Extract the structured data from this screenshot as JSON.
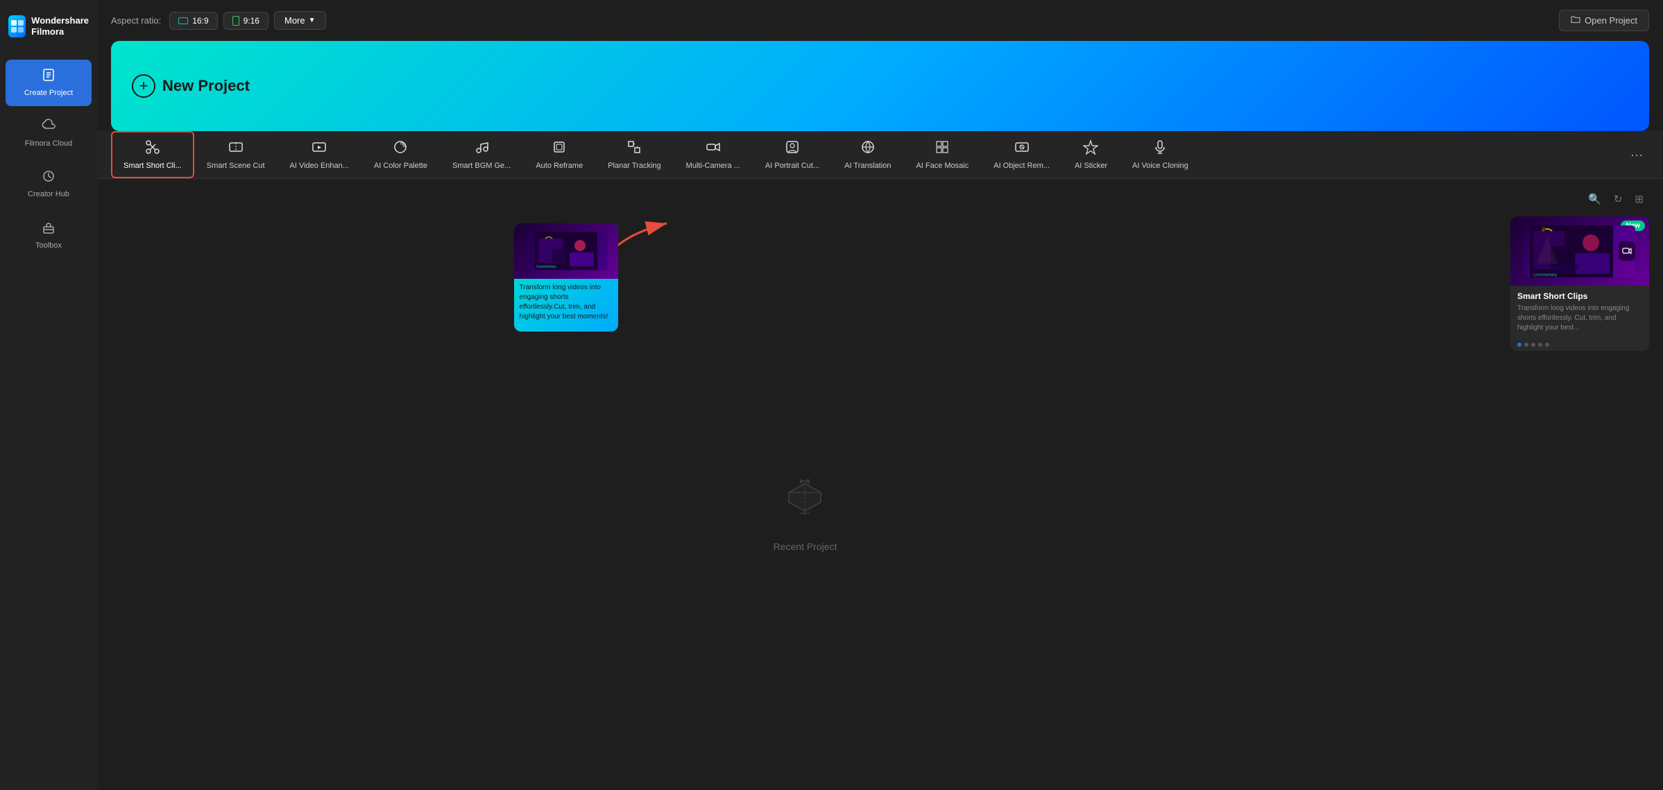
{
  "app": {
    "name": "Wondershare",
    "name2": "Filmora"
  },
  "sidebar": {
    "items": [
      {
        "id": "create-project",
        "label": "Create Project",
        "icon": "📄",
        "active": true
      },
      {
        "id": "filmora-cloud",
        "label": "Filmora Cloud",
        "icon": "☁"
      },
      {
        "id": "creator-hub",
        "label": "Creator Hub",
        "icon": "🎨"
      },
      {
        "id": "toolbox",
        "label": "Toolbox",
        "icon": "🧰"
      }
    ]
  },
  "topbar": {
    "aspect_label": "Aspect ratio:",
    "ratio_16_9": "16:9",
    "ratio_9_16": "9:16",
    "more_label": "More",
    "open_project_label": "Open Project"
  },
  "hero": {
    "new_project_label": "New Project"
  },
  "features": [
    {
      "id": "smart-short-clips",
      "label": "Smart Short Cli...",
      "icon": "✂",
      "active": true
    },
    {
      "id": "smart-scene-cut",
      "label": "Smart Scene Cut",
      "icon": "🎬"
    },
    {
      "id": "ai-video-enhance",
      "label": "AI Video Enhan...",
      "icon": "✨"
    },
    {
      "id": "ai-color-palette",
      "label": "AI Color Palette",
      "icon": "🎨"
    },
    {
      "id": "smart-bgm-ge",
      "label": "Smart BGM Ge...",
      "icon": "🎵"
    },
    {
      "id": "auto-reframe",
      "label": "Auto Reframe",
      "icon": "⬜"
    },
    {
      "id": "planar-tracking",
      "label": "Planar Tracking",
      "icon": "🎯"
    },
    {
      "id": "multi-camera",
      "label": "Multi-Camera ...",
      "icon": "📷"
    },
    {
      "id": "ai-portrait-cut",
      "label": "AI Portrait Cut...",
      "icon": "👤"
    },
    {
      "id": "ai-translation",
      "label": "AI Translation",
      "icon": "🌐"
    },
    {
      "id": "ai-face-mosaic",
      "label": "AI Face Mosaic",
      "icon": "🔲"
    },
    {
      "id": "ai-object-rem",
      "label": "AI Object Rem...",
      "icon": "🖼"
    },
    {
      "id": "ai-sticker",
      "label": "AI Sticker",
      "icon": "⭐"
    },
    {
      "id": "ai-voice-cloning",
      "label": "AI Voice Cloning",
      "icon": "🎤"
    }
  ],
  "tooltip": {
    "text": "Transform long videos into engaging shorts effortlessly.Cut, trim, and highlight your best moments!"
  },
  "featured": {
    "badge": "New",
    "title": "Smart Short Clips",
    "description": "Transform long videos into engaging shorts effortlessly. Cut, trim, and highlight your best...",
    "dots": [
      true,
      false,
      false,
      false,
      false
    ]
  },
  "empty_state": {
    "label": "Recent Project"
  },
  "icons": {
    "search": "🔍",
    "refresh": "↻",
    "grid": "⊞"
  }
}
